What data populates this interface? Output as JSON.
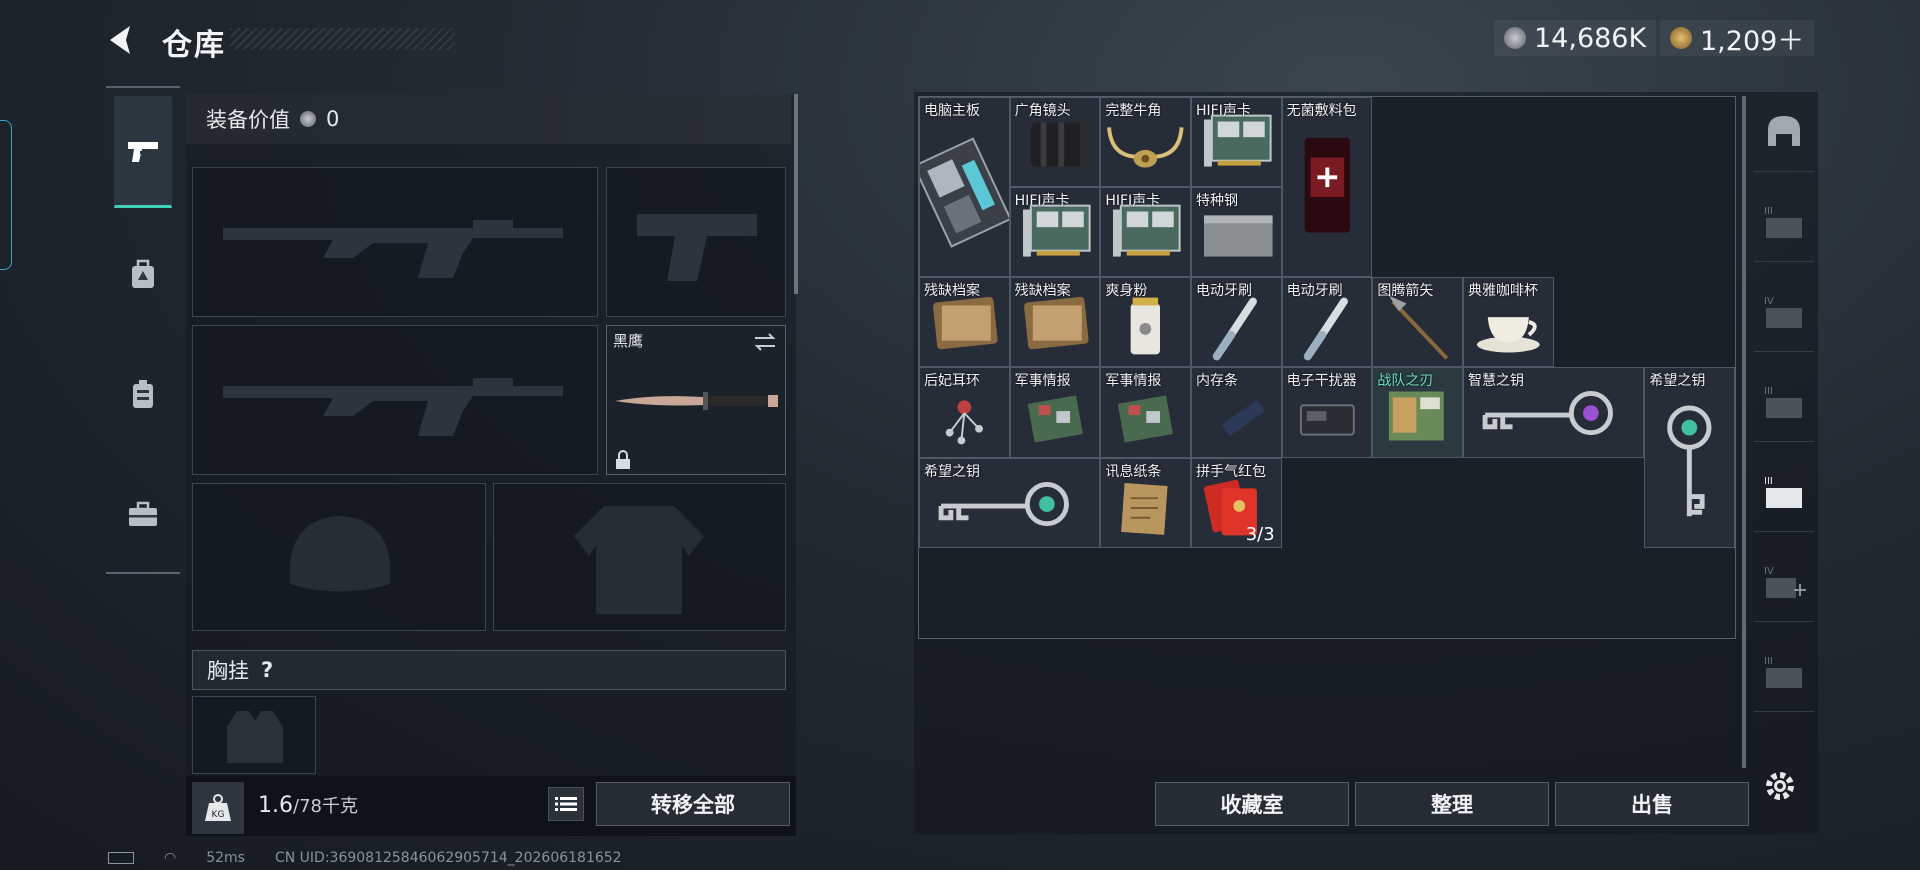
{
  "header": {
    "title": "仓库"
  },
  "currency": [
    {
      "icon": "silver-coin-icon",
      "value": "14,686K"
    },
    {
      "icon": "gold-coin-icon",
      "value": "1,209＋"
    }
  ],
  "left_tabs": [
    {
      "icon": "pistol-icon",
      "active": true
    },
    {
      "icon": "backpack-icon"
    },
    {
      "icon": "rig-icon"
    },
    {
      "icon": "toolbox-icon"
    }
  ],
  "equipment": {
    "value_label": "装备价值",
    "value": "0",
    "melee_name": "黑鹰",
    "chest_label": "胸挂",
    "chest_help": "?"
  },
  "weight": {
    "current": "1.6",
    "max": "/78千克"
  },
  "buttons": {
    "transfer_all": "转移全部",
    "collection": "收藏室",
    "organize": "整理",
    "sell": "出售"
  },
  "items": [
    {
      "name": "电脑主板",
      "icon": "motherboard-icon"
    },
    {
      "name": "广角镜头",
      "icon": "camera-lens-icon"
    },
    {
      "name": "完整牛角",
      "icon": "horns-icon"
    },
    {
      "name": "HIFI声卡",
      "icon": "sound-card-icon"
    },
    {
      "name": "无菌敷料包",
      "icon": "dressing-pack-icon"
    },
    {
      "name": "HIFI声卡",
      "icon": "sound-card-icon"
    },
    {
      "name": "HIFI声卡",
      "icon": "sound-card-icon"
    },
    {
      "name": "特种钢",
      "icon": "steel-ingot-icon"
    },
    {
      "name": "残缺档案",
      "icon": "document-icon"
    },
    {
      "name": "残缺档案",
      "icon": "document-icon"
    },
    {
      "name": "爽身粉",
      "icon": "powder-can-icon"
    },
    {
      "name": "电动牙刷",
      "icon": "toothbrush-icon"
    },
    {
      "name": "电动牙刷",
      "icon": "toothbrush-icon"
    },
    {
      "name": "图腾箭矢",
      "icon": "arrow-icon"
    },
    {
      "name": "典雅咖啡杯",
      "icon": "coffee-cup-icon"
    },
    {
      "name": "后妃耳环",
      "icon": "earring-icon"
    },
    {
      "name": "军事情报",
      "icon": "circuit-board-icon"
    },
    {
      "name": "军事情报",
      "icon": "circuit-board-icon"
    },
    {
      "name": "内存条",
      "icon": "ram-stick-icon"
    },
    {
      "name": "电子干扰器",
      "icon": "jammer-icon"
    },
    {
      "name": "战队之刃",
      "icon": "book-icon"
    },
    {
      "name": "智慧之钥",
      "icon": "key-icon"
    },
    {
      "name": "希望之钥",
      "icon": "key-icon"
    },
    {
      "name": "希望之钥",
      "icon": "key-icon"
    },
    {
      "name": "讯息纸条",
      "icon": "note-icon"
    },
    {
      "name": "拼手气红包",
      "icon": "red-envelope-icon",
      "count": "3/3"
    }
  ],
  "right_tabs": [
    {
      "icon": "helmet-tab-icon"
    },
    {
      "icon": "armor-3-tab-icon",
      "label": "III"
    },
    {
      "icon": "armor-4-tab-icon",
      "label": "IV"
    },
    {
      "icon": "armor-3b-tab-icon",
      "label": "III"
    },
    {
      "icon": "rig-3-tab-icon",
      "label": "III"
    },
    {
      "icon": "rig-4-add-tab-icon",
      "label": "IV"
    },
    {
      "icon": "armor-3c-tab-icon",
      "label": "III"
    }
  ],
  "status": {
    "ping": "52ms",
    "uid": "CN UID:36908125846062905714_202606181652"
  }
}
